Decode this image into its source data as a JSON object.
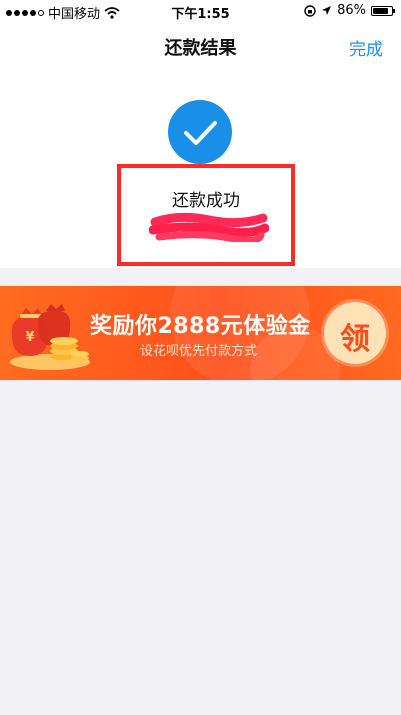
{
  "status_bar": {
    "carrier": "中国移动",
    "time": "下午1:55",
    "battery": "86%",
    "battery_level": 0.86
  },
  "nav": {
    "title": "还款结果",
    "done_label": "完成"
  },
  "result": {
    "status_text": "还款成功"
  },
  "banner": {
    "title": "奖励你2888元体验金",
    "subtitle": "设花呗优先付款方式",
    "claim_label": "领"
  },
  "colors": {
    "accent": "#1890ff",
    "check_bg": "#1a8fe8",
    "highlight_border": "#ff2a2a",
    "banner_orange": "#ff5a1f"
  }
}
